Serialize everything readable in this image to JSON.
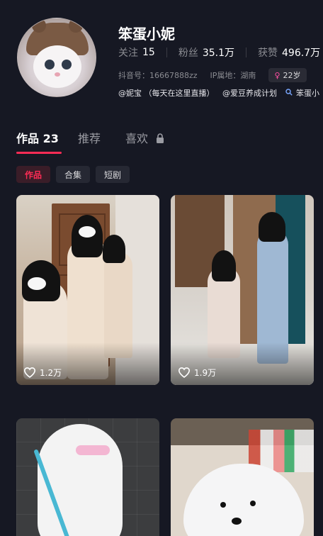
{
  "profile": {
    "name": "笨蛋小妮",
    "stats": [
      {
        "label": "关注",
        "value": "15"
      },
      {
        "label": "粉丝",
        "value": "35.1万"
      },
      {
        "label": "获赞",
        "value": "496.7万"
      }
    ],
    "douyin_id": "抖音号：16667888zz",
    "ip_location": "IP属地：湖南",
    "age_badge": "22岁",
    "age_symbol": "♀",
    "mentions": [
      "@妮宝 （每天在这里直播）",
      "@爱豆养成计划",
      "笨蛋小"
    ],
    "mention_search_icon": "search-icon"
  },
  "tabs": [
    {
      "label": "作品 23",
      "active": true
    },
    {
      "label": "推荐",
      "active": false
    },
    {
      "label": "喜欢",
      "active": false,
      "icon": "lock-icon"
    }
  ],
  "filters": [
    {
      "label": "作品",
      "active": true
    },
    {
      "label": "合集",
      "active": false
    },
    {
      "label": "短剧",
      "active": false
    }
  ],
  "videos": [
    {
      "likes": "1.2万"
    },
    {
      "likes": "1.9万"
    },
    {
      "likes": ""
    },
    {
      "likes": ""
    }
  ],
  "colors": {
    "background": "#161823",
    "accent": "#fe2c55",
    "muted": "#8a8b91"
  }
}
